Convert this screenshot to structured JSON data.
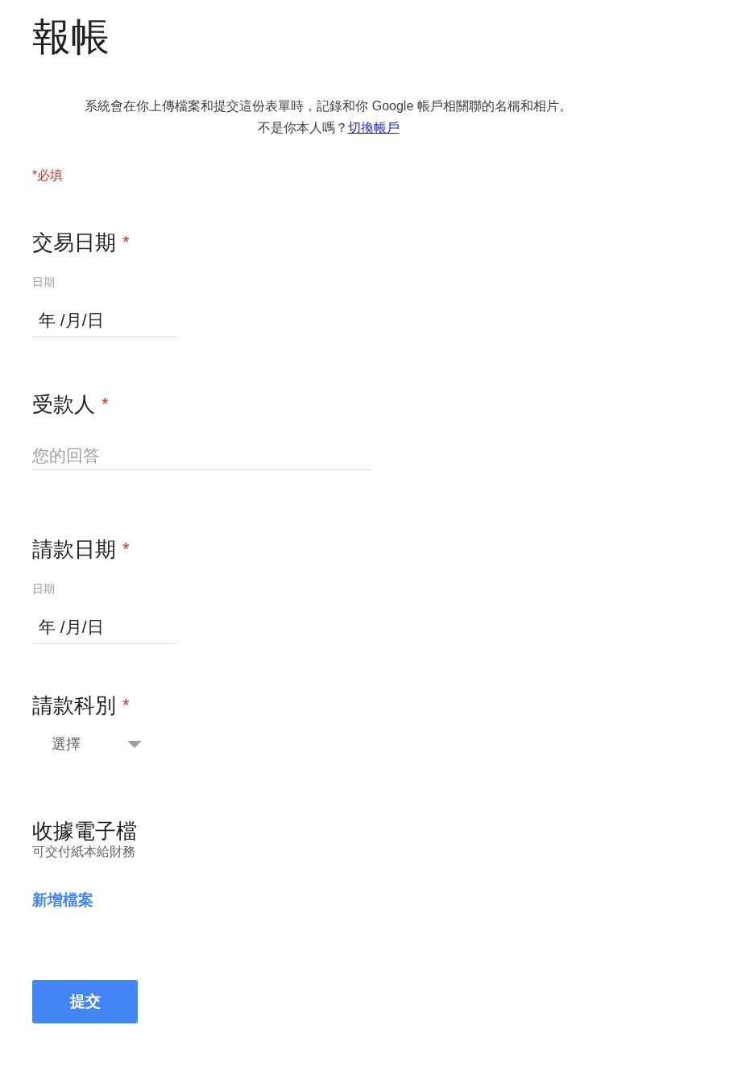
{
  "title": "報帳",
  "description": "系統會在你上傳檔案和提交這份表單時，記錄和你 Google 帳戶相關聯的名稱和相片。",
  "account_prompt": "不是你本人嗎？",
  "switch_account_link": "切換帳戶",
  "required_note": "*必填",
  "questions": [
    {
      "kind": "date",
      "title": "交易日期",
      "required_mark": "*",
      "field_label": "日期",
      "value": "年 /月/日"
    },
    {
      "kind": "text",
      "title": "受款人",
      "required_mark": "*",
      "placeholder": "您的回答"
    },
    {
      "kind": "date",
      "title": "請款日期",
      "required_mark": "*",
      "field_label": "日期",
      "value": "年 /月/日"
    },
    {
      "kind": "select",
      "title": "請款科別",
      "required_mark": "*",
      "value": "選擇"
    },
    {
      "kind": "file",
      "title": "收據電子檔",
      "help": "可交付紙本給財務",
      "button": "新增檔案"
    }
  ],
  "submit_button": "提交"
}
